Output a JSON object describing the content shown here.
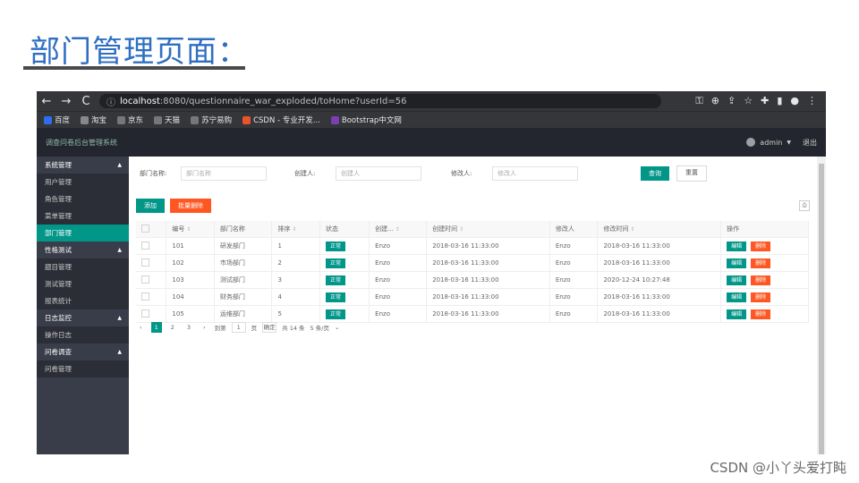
{
  "slide": {
    "title": "部门管理页面：",
    "watermark": "CSDN @小丫头爱打盹"
  },
  "browser": {
    "back": "←",
    "forward": "→",
    "reload": "C",
    "info": "ⓘ",
    "url_host": "localhost",
    "url_rest": ":8080/questionnaire_war_exploded/toHome?userId=56",
    "toolbar_icons": [
      "key",
      "zoom",
      "share",
      "star",
      "puzzle",
      "panel",
      "profile",
      "menu"
    ],
    "bookmarks": [
      {
        "label": "百度",
        "icon": "baidu-icon",
        "color": "#2f6df0"
      },
      {
        "label": "淘宝",
        "icon": "taobao-icon",
        "color": "#888888"
      },
      {
        "label": "京东",
        "icon": "globe-icon",
        "color": "#777777"
      },
      {
        "label": "天猫",
        "icon": "globe-icon",
        "color": "#777777"
      },
      {
        "label": "苏宁易购",
        "icon": "globe-icon",
        "color": "#777777"
      },
      {
        "label": "CSDN - 专业开发...",
        "icon": "csdn-icon",
        "color": "#e8542b"
      },
      {
        "label": "Bootstrap中文网",
        "icon": "bootstrap-icon",
        "color": "#7a3fb0"
      }
    ]
  },
  "app": {
    "brand": "调查问卷后台管理系统",
    "user": "admin",
    "logout": "退出",
    "sidebar": [
      {
        "type": "group",
        "label": "系统管理"
      },
      {
        "type": "item",
        "label": "用户管理"
      },
      {
        "type": "item",
        "label": "角色管理"
      },
      {
        "type": "item",
        "label": "菜单管理"
      },
      {
        "type": "item",
        "label": "部门管理",
        "active": true
      },
      {
        "type": "group",
        "label": "性格测试"
      },
      {
        "type": "item",
        "label": "题目管理"
      },
      {
        "type": "item",
        "label": "测试管理"
      },
      {
        "type": "item",
        "label": "报表统计"
      },
      {
        "type": "group",
        "label": "日志监控"
      },
      {
        "type": "item",
        "label": "操作日志"
      },
      {
        "type": "group",
        "label": "问卷调查"
      },
      {
        "type": "item",
        "label": "问卷管理"
      }
    ],
    "filters": {
      "dept_label": "部门名称:",
      "dept_placeholder": "部门名称",
      "creator_label": "创建人:",
      "creator_placeholder": "创建人",
      "modifier_label": "修改人:",
      "modifier_placeholder": "修改人",
      "query": "查询",
      "reset": "重置"
    },
    "actions": {
      "add": "添加",
      "batch_delete": "批量删除"
    },
    "table": {
      "headers": [
        "编号",
        "部门名称",
        "排序",
        "状态",
        "创建...",
        "创建时间",
        "修改人",
        "修改时间",
        "操作"
      ],
      "rows": [
        {
          "id": "101",
          "name": "研发部门",
          "order": "1",
          "status": "正常",
          "creator": "Enzo",
          "created": "2018-03-16 11:33:00",
          "modifier": "Enzo",
          "modified": "2018-03-16 11:33:00"
        },
        {
          "id": "102",
          "name": "市场部门",
          "order": "2",
          "status": "正常",
          "creator": "Enzo",
          "created": "2018-03-16 11:33:00",
          "modifier": "Enzo",
          "modified": "2018-03-16 11:33:00"
        },
        {
          "id": "103",
          "name": "测试部门",
          "order": "3",
          "status": "正常",
          "creator": "Enzo",
          "created": "2018-03-16 11:33:00",
          "modifier": "Enzo",
          "modified": "2020-12-24 10:27:48"
        },
        {
          "id": "104",
          "name": "财务部门",
          "order": "4",
          "status": "正常",
          "creator": "Enzo",
          "created": "2018-03-16 11:33:00",
          "modifier": "Enzo",
          "modified": "2018-03-16 11:33:00"
        },
        {
          "id": "105",
          "name": "运维部门",
          "order": "5",
          "status": "正常",
          "creator": "Enzo",
          "created": "2018-03-16 11:33:00",
          "modifier": "Enzo",
          "modified": "2018-03-16 11:33:00"
        }
      ],
      "edit": "编辑",
      "delete": "删除"
    },
    "pager": {
      "pages": [
        "1",
        "2",
        "3"
      ],
      "goto": "到第",
      "page_value": "1",
      "page_unit": "页",
      "confirm": "确定",
      "total": "共 14 条",
      "page_size": "5 条/页"
    }
  }
}
